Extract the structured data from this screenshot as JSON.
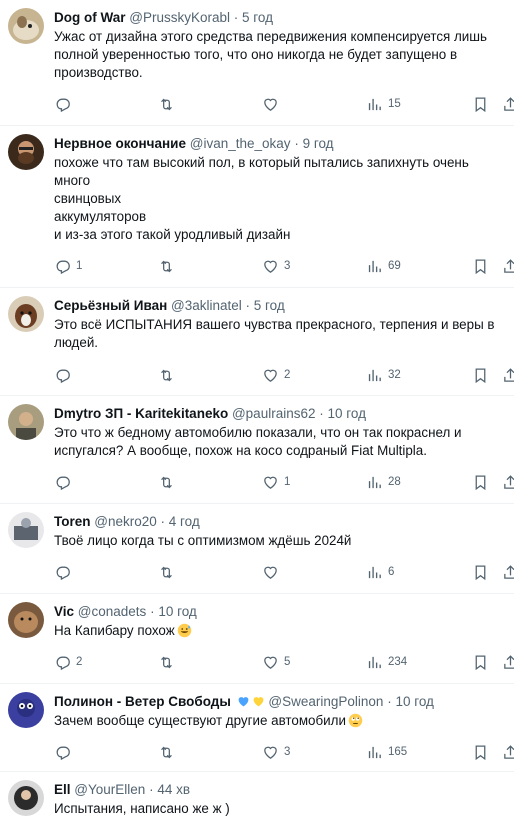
{
  "tweets": [
    {
      "name": "Dog of War",
      "handle": "@PrusskyKorabl",
      "time": "5 год",
      "text": "Ужас от дизайна этого средства передвижения компенсируется лишь полной уверенностью того, что оно никогда не будет запущено в производство.",
      "replies": "",
      "retweets": "",
      "likes": "",
      "views": "15",
      "avatar_color": "#b9a27a"
    },
    {
      "name": "Нервное окончание",
      "handle": "@ivan_the_okay",
      "time": "9 год",
      "text": "похоже что там высокий пол, в который пытались запихнуть очень много\nсвинцовых\nаккумуляторов\nи из-за этого такой уродливый дизайн",
      "replies": "1",
      "retweets": "",
      "likes": "3",
      "views": "69",
      "avatar_color": "#6b4a2c"
    },
    {
      "name": "Серьёзный Иван",
      "handle": "@3aklinatel",
      "time": "5 год",
      "text": "Это всё ИСПЫТАНИЯ вашего чувства прекрасного, терпения и веры в людей.",
      "replies": "",
      "retweets": "",
      "likes": "2",
      "views": "32",
      "avatar_color": "#8a5a3a"
    },
    {
      "name": "Dmytro ЗП - Karitekitaneko",
      "handle": "@paulrains62",
      "time": "10 год",
      "text": "Это что ж бедному автомобилю показали, что он так покраснел и испугался? А вообще, похож на косо содраный Fiat Multipla.",
      "replies": "",
      "retweets": "",
      "likes": "1",
      "views": "28",
      "avatar_color": "#7d7560"
    },
    {
      "name": "Toren",
      "handle": "@nekro20",
      "time": "4 год",
      "text": "Твоё лицо когда ты с оптимизмом ждёшь 2024й",
      "replies": "",
      "retweets": "",
      "likes": "",
      "views": "6",
      "avatar_color": "#5c6470"
    },
    {
      "name": "Vic",
      "handle": "@conadets",
      "time": "10 год",
      "text": "На Капибару похож",
      "replies": "2",
      "retweets": "",
      "likes": "5",
      "views": "234",
      "avatar_color": "#9a6b4a"
    },
    {
      "name": "Полинон - Ветер Свободы",
      "handle": "@SwearingPolinon",
      "time": "10 год",
      "text": "Зачем вообще существуют другие автомобили",
      "replies": "",
      "retweets": "",
      "likes": "3",
      "views": "165",
      "avatar_color": "#3a3fa0"
    },
    {
      "name": "Ell",
      "handle": "@YourEllen",
      "time": "44 хв",
      "text": "Испытания, написано же ж )",
      "avatar_color": "#2b2b2b"
    }
  ],
  "separator": "·",
  "icons": {
    "reply": "reply-icon",
    "retweet": "retweet-icon",
    "like": "heart-icon",
    "views": "views-icon",
    "bookmark": "bookmark-icon",
    "share": "share-icon"
  },
  "colors": {
    "text": "#0f1419",
    "secondary": "#536471",
    "divider": "#eff3f4",
    "heart_blue": "#4aa3ff",
    "heart_yellow": "#ffd43b"
  }
}
